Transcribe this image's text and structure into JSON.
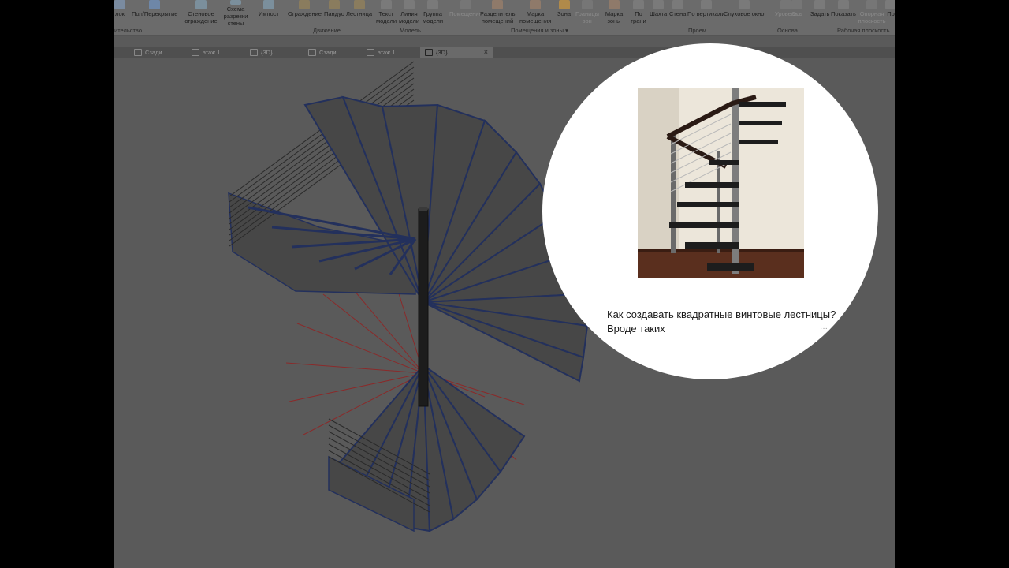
{
  "ribbon": {
    "buttons": [
      {
        "label": "лок",
        "dim": false
      },
      {
        "label": "Пол/Перекрытие",
        "dim": false
      },
      {
        "label": "Стеновое ограждение",
        "dim": false
      },
      {
        "label": "Схема разрезки стены",
        "dim": false
      },
      {
        "label": "Импост",
        "dim": false
      },
      {
        "label": "Ограждение",
        "dim": false
      },
      {
        "label": "Пандус",
        "dim": false
      },
      {
        "label": "Лестница",
        "dim": false
      },
      {
        "label": "Текст модели",
        "dim": false
      },
      {
        "label": "Линия модели",
        "dim": false
      },
      {
        "label": "Группа модели",
        "dim": false
      },
      {
        "label": "Помещение",
        "dim": true
      },
      {
        "label": "Разделитель помещений",
        "dim": false
      },
      {
        "label": "Марка помещения",
        "dim": false
      },
      {
        "label": "Зона",
        "dim": false
      },
      {
        "label": "Границы зон",
        "dim": true
      },
      {
        "label": "Марка зоны",
        "dim": false
      },
      {
        "label": "По грани",
        "dim": false
      },
      {
        "label": "Шахта",
        "dim": false
      },
      {
        "label": "Стена",
        "dim": false
      },
      {
        "label": "По вертикали",
        "dim": false
      },
      {
        "label": "Слуховое окно",
        "dim": false
      },
      {
        "label": "Уровень",
        "dim": true
      },
      {
        "label": "Ось",
        "dim": true
      },
      {
        "label": "Задать",
        "dim": false
      },
      {
        "label": "Показать",
        "dim": false
      },
      {
        "label": "Опорная плоскость",
        "dim": true
      },
      {
        "label": "Пр",
        "dim": false
      }
    ],
    "groups": [
      "ительство",
      "Движение",
      "Модель",
      "Помещения и зоны ▾",
      "Проем",
      "Основа",
      "Рабочая плоскость"
    ]
  },
  "tabs": [
    {
      "label": "Сзади",
      "active": false
    },
    {
      "label": "этаж 1",
      "active": false
    },
    {
      "label": "{3D}",
      "active": false
    },
    {
      "label": "Сзади",
      "active": false
    },
    {
      "label": "этаж 1",
      "active": false
    },
    {
      "label": "{3D}",
      "active": true
    }
  ],
  "tab_close_glyph": "×",
  "overlay": {
    "question_line1": "Как создавать квадратные винтовые лестницы?",
    "question_line2": "Вроде таких",
    "more_glyph": "···"
  },
  "colors": {
    "ribbon_bg": "#6b6b6b",
    "viewport_bg": "#5a5a5a",
    "tread_fill": "#474747",
    "tread_edge": "#23305c",
    "guide_line": "#8a2a2a",
    "railing": "#2a2a2a"
  }
}
